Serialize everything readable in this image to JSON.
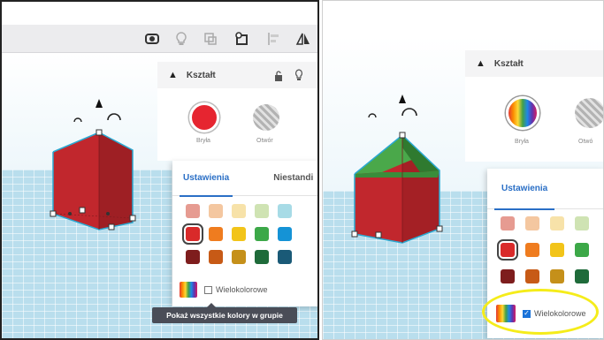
{
  "left": {
    "panel": {
      "title": "Kształt",
      "solid_label": "Bryła",
      "hole_label": "Otwór"
    },
    "tabs": [
      "Ustawienia",
      "Niestandi"
    ],
    "multicolor_label": "Wielokolorowe",
    "multicolor_checked": false,
    "tooltip": "Pokaż wszystkie kolory w grupie",
    "shape_color": "#c1272d"
  },
  "right": {
    "panel": {
      "title": "Kształt",
      "solid_label": "Bryła",
      "hole_label": "Otwó"
    },
    "tabs": [
      "Ustawienia"
    ],
    "multicolor_label": "Wielokolorowe",
    "multicolor_checked": true,
    "shape_color": "#c1272d",
    "roof_color": "#3c9a3c",
    "highlight_color": "#f5ec1a"
  },
  "palette": {
    "row1": [
      "#e69b91",
      "#f4c7a0",
      "#f7e2a9",
      "#cfe3b3",
      "#a7dbe6"
    ],
    "row2": [
      "#d92a2a",
      "#ef7c1f",
      "#f2c419",
      "#3ca848",
      "#1593d6"
    ],
    "row3": [
      "#7e1d1d",
      "#c75a16",
      "#c5901a",
      "#1f6b3a",
      "#1a5a77"
    ],
    "selected": "#d92a2a"
  },
  "toolbar": {
    "icons": [
      "camera-icon",
      "bulb-icon",
      "duplicate-icon",
      "group-icon",
      "align-icon",
      "mirror-icon"
    ]
  },
  "grid_color": "#b9deed"
}
